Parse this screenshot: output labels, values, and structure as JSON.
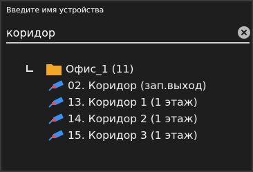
{
  "search": {
    "label": "Введите имя устройства",
    "value": "коридор"
  },
  "tree": {
    "folder": {
      "label": "Офис_1 (11)"
    },
    "devices": [
      {
        "label": "02. Коридор (зап.выход)"
      },
      {
        "label": "13. Коридор 1 (1 этаж)"
      },
      {
        "label": "14. Коридор 2 (1 этаж)"
      },
      {
        "label": "15. Коридор 3 (1 этаж)"
      }
    ]
  },
  "icons": {
    "clear": "close-circle-icon",
    "folder": "folder-icon",
    "camera": "camera-icon",
    "connector": "tree-connector-icon"
  },
  "colors": {
    "folder": "#f4a724",
    "camera": "#3b8ff0",
    "camera_accent": "#e05050"
  }
}
